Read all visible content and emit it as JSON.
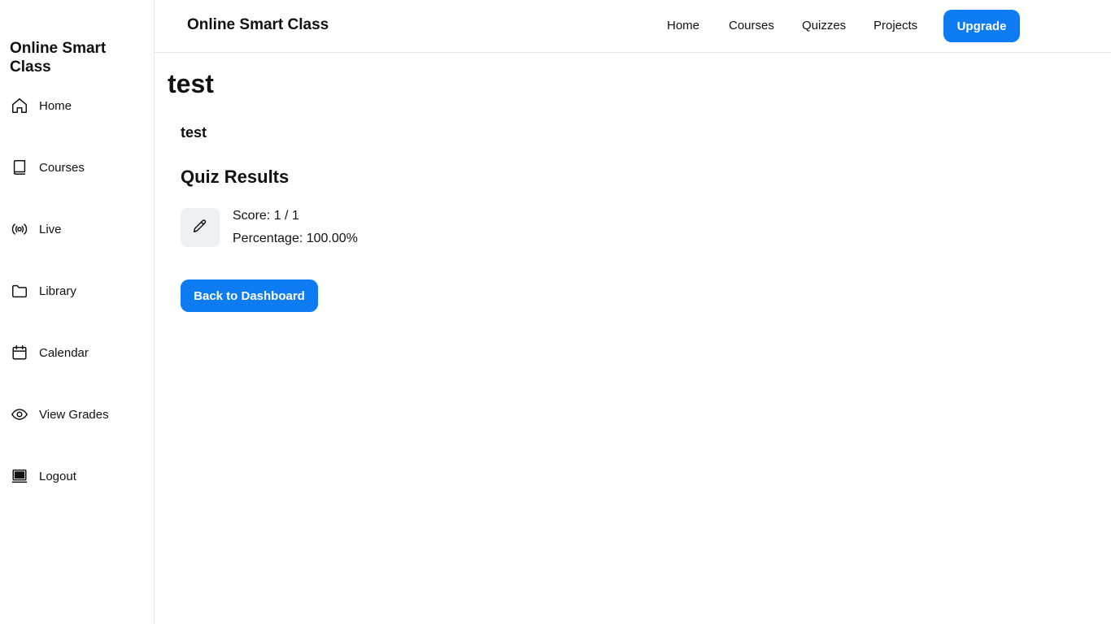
{
  "sidebar": {
    "brand": "Online Smart Class",
    "items": [
      {
        "label": "Home",
        "icon": "home-icon"
      },
      {
        "label": "Courses",
        "icon": "book-icon"
      },
      {
        "label": "Live",
        "icon": "broadcast-icon"
      },
      {
        "label": "Library",
        "icon": "folder-icon"
      },
      {
        "label": "Calendar",
        "icon": "calendar-icon"
      },
      {
        "label": "View Grades",
        "icon": "eye-icon"
      },
      {
        "label": "Logout",
        "icon": "logout-icon"
      }
    ]
  },
  "header": {
    "title": "Online Smart Class",
    "nav": [
      {
        "label": "Home"
      },
      {
        "label": "Courses"
      },
      {
        "label": "Quizzes"
      },
      {
        "label": "Projects"
      }
    ],
    "upgrade_label": "Upgrade"
  },
  "main": {
    "title": "test",
    "subtitle": "test",
    "results": {
      "heading": "Quiz Results",
      "icon": "pencil-icon",
      "score": "Score: 1 / 1",
      "percentage": "Percentage: 100.00%"
    },
    "back_label": "Back to Dashboard"
  },
  "colors": {
    "accent": "#0d7cf2",
    "icon_box_bg": "#eef0f3",
    "border": "#e6e6e6"
  }
}
